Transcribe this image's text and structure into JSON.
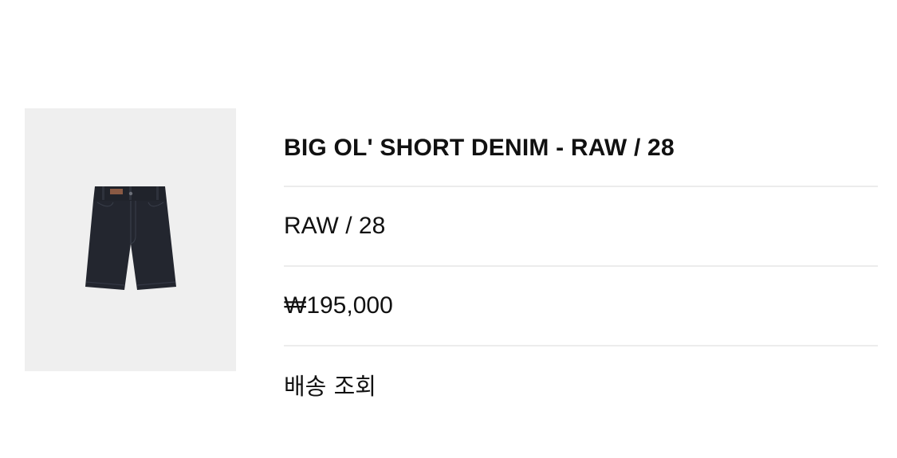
{
  "product": {
    "image_icon": "denim-shorts-image",
    "title": "BIG OL' SHORT DENIM - RAW / 28",
    "option": "RAW / 28",
    "price": "₩195,000",
    "shipping_link": "배송 조회"
  },
  "colors": {
    "thumbnail_bg": "#efefef",
    "denim": "#23262f",
    "divider": "#ececec"
  }
}
